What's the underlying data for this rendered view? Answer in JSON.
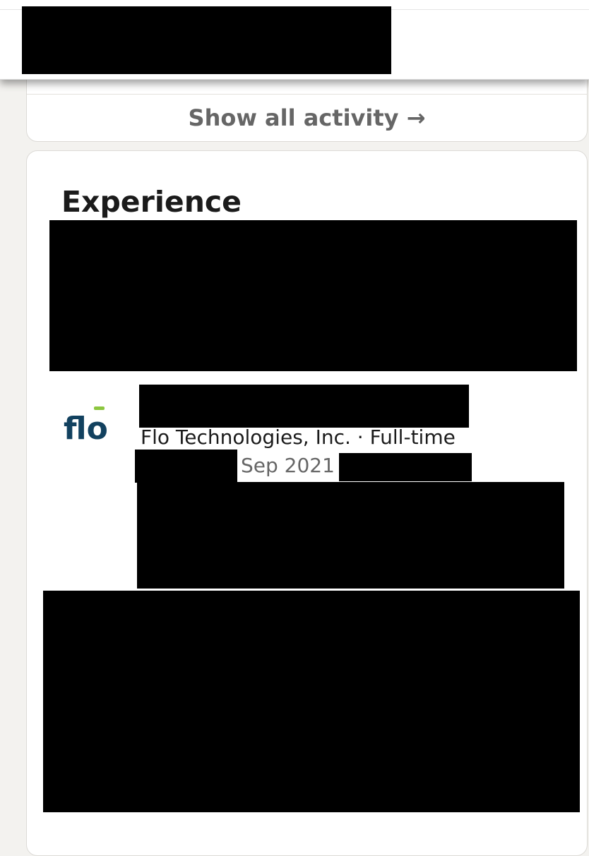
{
  "activity": {
    "show_all_label": "Show all activity →"
  },
  "experience": {
    "title": "Experience",
    "items": [
      {
        "logo_text": "flo",
        "company_line": "Flo Technologies, Inc. · Full-time",
        "start_date": "Sep 2021"
      }
    ]
  },
  "colors": {
    "page_bg": "#f3f2ef",
    "card_bg": "#ffffff",
    "link_gray": "#666666",
    "text_dark": "#1b1b1b",
    "logo_navy": "#12415f",
    "logo_green": "#8cc63f",
    "redaction": "#000000"
  }
}
